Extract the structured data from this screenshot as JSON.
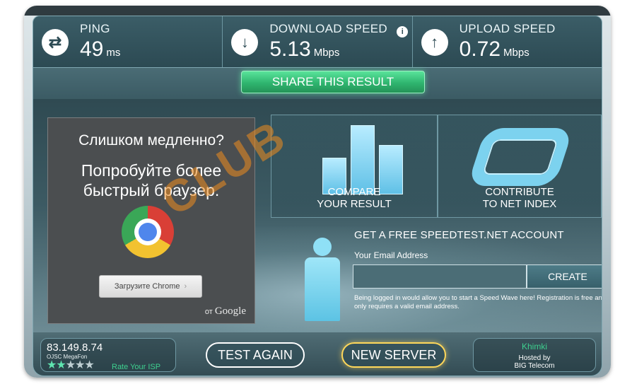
{
  "header": {
    "ping": {
      "label": "PING",
      "value": "49",
      "unit": "ms",
      "icon": "swap-arrows-icon"
    },
    "download": {
      "label": "DOWNLOAD SPEED",
      "value": "5.13",
      "unit": "Mbps",
      "icon": "download-arrow-icon",
      "info": "i"
    },
    "upload": {
      "label": "UPLOAD SPEED",
      "value": "0.72",
      "unit": "Mbps",
      "icon": "upload-arrow-icon"
    }
  },
  "share": {
    "label": "SHARE THIS RESULT"
  },
  "ad": {
    "headline": "Слишком медленно?",
    "body": "Попробуйте более быстрый браузер.",
    "button": "Загрузите Chrome",
    "by": "от",
    "brand": "Google"
  },
  "tiles": {
    "compare": [
      "COMPARE",
      "YOUR RESULT"
    ],
    "contribute": [
      "CONTRIBUTE",
      "TO NET INDEX"
    ]
  },
  "signup": {
    "title": "GET A FREE SPEEDTEST.NET ACCOUNT",
    "email_label": "Your Email Address",
    "email_value": "",
    "create": "CREATE",
    "note": "Being logged in would allow you to start a Speed Wave here! Registration is free and only requires a valid email address."
  },
  "footer": {
    "ip": "83.149.8.74",
    "isp": "OJSC MegaFon",
    "rating": 2,
    "rating_max": 5,
    "rate_label": "Rate Your ISP",
    "test_again": "TEST AGAIN",
    "new_server": "NEW SERVER",
    "city": "Khimki",
    "hosted_by": "Hosted by",
    "host": "BIG Telecom"
  },
  "colors": {
    "accent_green": "#2fb56f",
    "server_outline": "#ffd85a",
    "panel": "#2c4a53"
  }
}
